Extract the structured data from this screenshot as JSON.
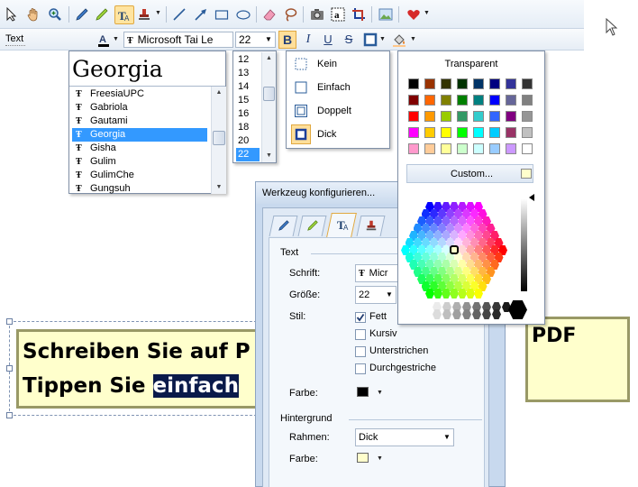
{
  "toolbar2": {
    "mode_label": "Text",
    "font_name": "Microsoft Tai Le",
    "font_size": "22",
    "bold": "B",
    "italic": "I",
    "underline": "U",
    "strike": "S"
  },
  "font_list": {
    "preview": "Georgia",
    "items": [
      "FreesiaUPC",
      "Gabriola",
      "Gautami",
      "Georgia",
      "Gisha",
      "Gulim",
      "GulimChe",
      "Gungsuh"
    ],
    "selected_index": 3
  },
  "size_list": {
    "items": [
      "12",
      "13",
      "14",
      "15",
      "16",
      "18",
      "20",
      "22"
    ],
    "selected_index": 7
  },
  "frame_menu": {
    "items": [
      {
        "label": "Kein",
        "icon": "border-none-icon"
      },
      {
        "label": "Einfach",
        "icon": "border-single-icon"
      },
      {
        "label": "Doppelt",
        "icon": "border-double-icon"
      },
      {
        "label": "Dick",
        "icon": "border-thick-icon"
      }
    ],
    "selected_index": 3
  },
  "color_popup": {
    "title": "Transparent",
    "custom_label": "Custom...",
    "palette": [
      [
        "#000000",
        "#993300",
        "#333300",
        "#003300",
        "#003366",
        "#000080",
        "#333399",
        "#333333"
      ],
      [
        "#800000",
        "#ff6600",
        "#808000",
        "#008000",
        "#008080",
        "#0000ff",
        "#666699",
        "#808080"
      ],
      [
        "#ff0000",
        "#ff9900",
        "#99cc00",
        "#339966",
        "#33cccc",
        "#3366ff",
        "#800080",
        "#969696"
      ],
      [
        "#ff00ff",
        "#ffcc00",
        "#ffff00",
        "#00ff00",
        "#00ffff",
        "#00ccff",
        "#993366",
        "#c0c0c0"
      ],
      [
        "#ff99cc",
        "#ffcc99",
        "#ffff99",
        "#ccffcc",
        "#ccffff",
        "#99ccff",
        "#cc99ff",
        "#ffffff"
      ]
    ]
  },
  "dialog": {
    "title": "Werkzeug konfigurieren...",
    "section_text": "Text",
    "font_label": "Schrift:",
    "font_value": "Micr",
    "size_label": "Größe:",
    "size_value": "22",
    "style_label": "Stil:",
    "styles": [
      {
        "label": "Fett",
        "checked": true
      },
      {
        "label": "Kursiv",
        "checked": false
      },
      {
        "label": "Unterstrichen",
        "checked": false
      },
      {
        "label": "Durchgestriche",
        "checked": false
      }
    ],
    "color_label": "Farbe:",
    "color_value": "#000000",
    "section_bg": "Hintergrund",
    "frame_label": "Rahmen:",
    "frame_value": "Dick",
    "bg_color_label": "Farbe:",
    "bg_color_value": "#ffffcc"
  },
  "canvas": {
    "line1": "Schreiben Sie auf P",
    "line2_prefix": "Tippen Sie ",
    "line2_highlight": "einfach",
    "note_text": "PDF",
    "note_color": "#ffffcc",
    "frame_color": "#999966"
  }
}
